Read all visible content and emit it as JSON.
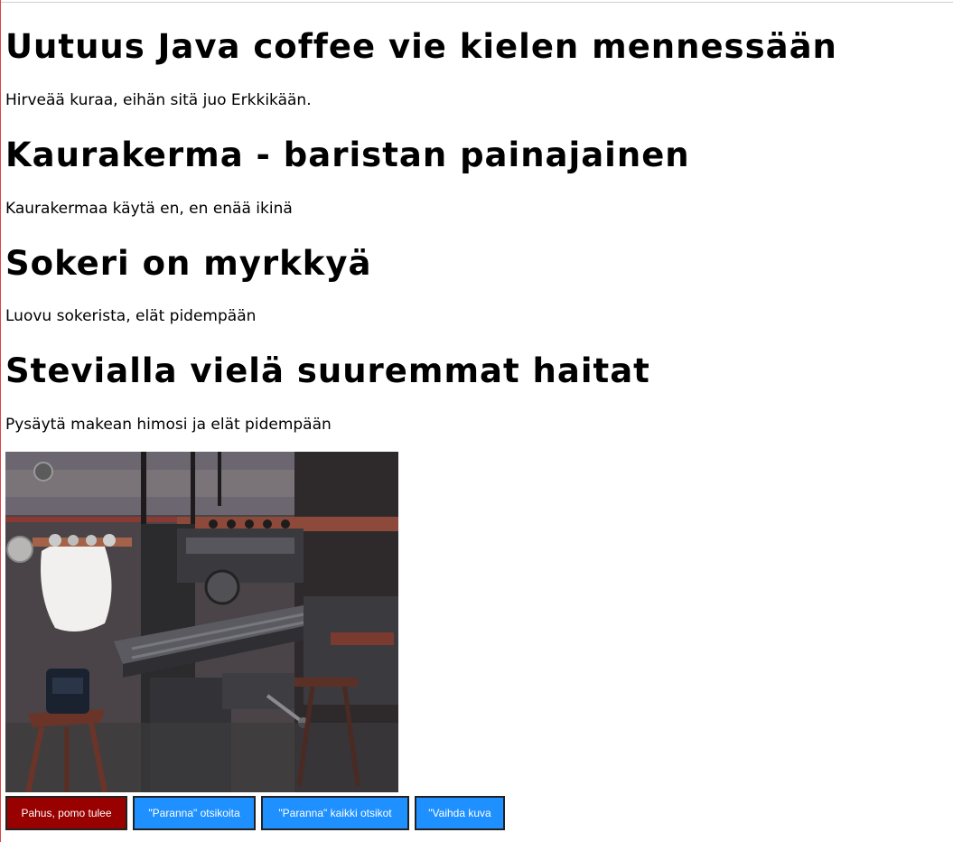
{
  "articles": [
    {
      "title": "Uutuus Java coffee vie kielen mennessään",
      "text": "Hirveää kuraa, eihän sitä juo Erkkikään."
    },
    {
      "title": "Kaurakerma - baristan painajainen",
      "text": "Kaurakermaa käytä en, en enää ikinä"
    },
    {
      "title": "Sokeri on myrkkyä",
      "text": "Luovu sokerista, elät pidempään"
    },
    {
      "title": "Stevialla vielä suuremmat haitat",
      "text": "Pysäytä makean himosi ja elät pidempään"
    }
  ],
  "buttons": {
    "boss": "Pahus, pomo tulee",
    "improve_headings": "\"Paranna\" otsikoita",
    "improve_all": "\"Paranna\" kaikki otsikot",
    "change_image": "\"Vaihda kuva"
  },
  "colors": {
    "boss_button": "#990000",
    "action_button": "#1e90ff"
  }
}
